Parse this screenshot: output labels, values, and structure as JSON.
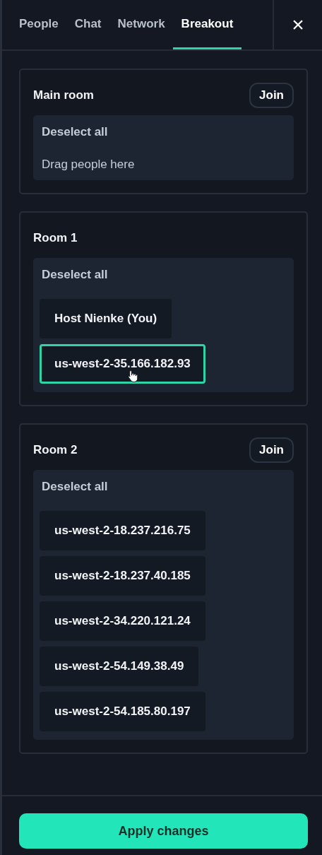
{
  "tabs": [
    {
      "label": "People",
      "selected": false
    },
    {
      "label": "Chat",
      "selected": false
    },
    {
      "label": "Network",
      "selected": false
    },
    {
      "label": "Breakout",
      "selected": true
    }
  ],
  "close": "×",
  "rooms": [
    {
      "name": "Main room",
      "join": "Join",
      "deselect": "Deselect all",
      "placeholder": "Drag people here"
    },
    {
      "name": "Room 1",
      "deselect": "Deselect all",
      "participants": [
        {
          "name": "Host Nienke (You)",
          "selected": false
        },
        {
          "name": "us-west-2-35.166.182.93",
          "selected": true
        }
      ]
    },
    {
      "name": "Room 2",
      "join": "Join",
      "deselect": "Deselect all",
      "participants": [
        {
          "name": "us-west-2-18.237.216.75",
          "selected": false
        },
        {
          "name": "us-west-2-18.237.40.185",
          "selected": false
        },
        {
          "name": "us-west-2-34.220.121.24",
          "selected": false
        },
        {
          "name": "us-west-2-54.149.38.49",
          "selected": false
        },
        {
          "name": "us-west-2-54.185.80.197",
          "selected": false
        }
      ]
    }
  ],
  "apply": "Apply changes"
}
